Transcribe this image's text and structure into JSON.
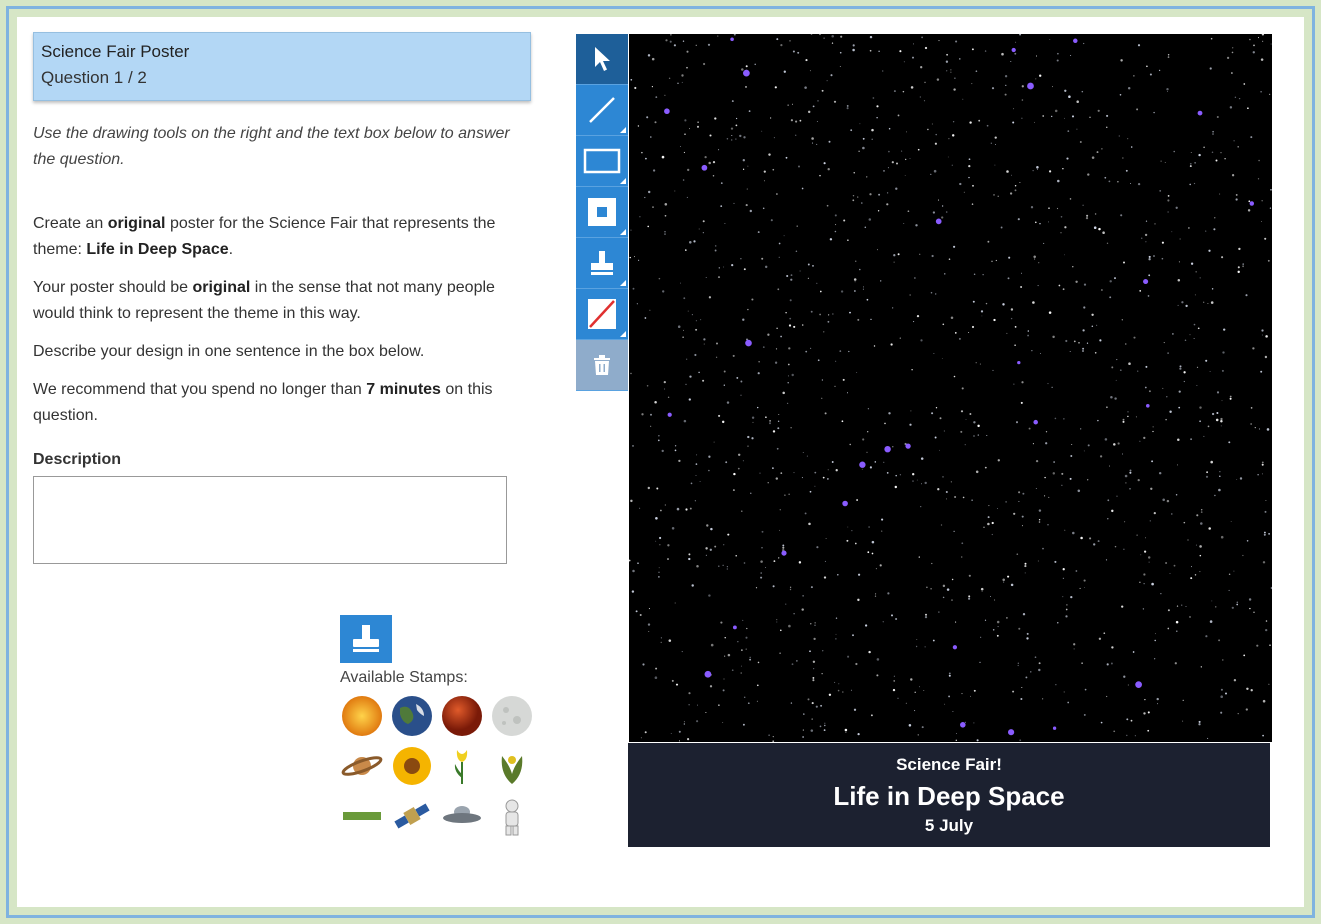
{
  "header": {
    "title": "Science Fair Poster",
    "question_number": "Question 1 / 2"
  },
  "instructions": "Use the drawing tools on the right and the text box below to answer the question.",
  "question": {
    "p1_pre": "Create an ",
    "p1_bold": "original",
    "p1_mid": " poster for the Science Fair that represents the theme: ",
    "p1_theme": "Life in Deep Space",
    "p1_end": ".",
    "p2_pre": "Your poster should be ",
    "p2_bold": "original",
    "p2_end": " in the sense that not many people would think to represent the theme in this way.",
    "p3": "Describe your design in one sentence in the box below.",
    "p4_pre": "We recommend that you spend no longer than ",
    "p4_bold": "7 minutes",
    "p4_end": " on this question."
  },
  "description": {
    "label": "Description",
    "value": ""
  },
  "stamps": {
    "label": "Available Stamps:",
    "items": [
      "sun-stamp",
      "earth-stamp",
      "mars-stamp",
      "moon-stamp",
      "saturn-stamp",
      "sunflower-stamp",
      "tulip-stamp",
      "plant-stamp",
      "bar-stamp",
      "satellite-stamp",
      "ufo-stamp",
      "astronaut-stamp"
    ]
  },
  "toolbar": {
    "tools": [
      "select-tool",
      "line-tool",
      "rectangle-tool",
      "filled-rectangle-tool",
      "stamp-tool",
      "color-tool",
      "delete-tool"
    ],
    "active": "select-tool"
  },
  "poster": {
    "line1": "Science Fair!",
    "line2": "Life in Deep Space",
    "line3": "5 July"
  },
  "colors": {
    "header_bg": "#b3d7f5",
    "tool_bg": "#2d87d4",
    "tool_active": "#1e5f99",
    "caption_bg": "#1c2130",
    "frame_border": "#7fb3e0"
  }
}
